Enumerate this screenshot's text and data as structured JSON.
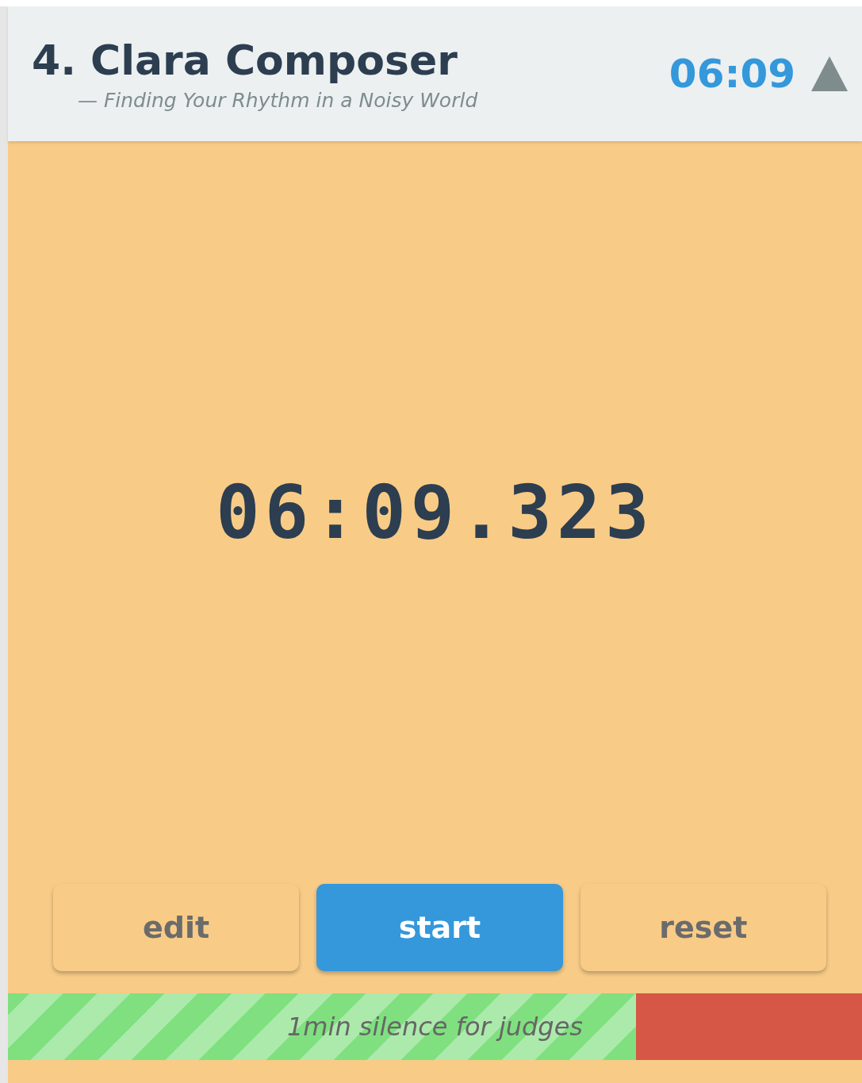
{
  "header": {
    "title": "4. Clara Composer",
    "subtitle": "— Finding Your Rhythm in a Noisy World",
    "time": "06:09"
  },
  "timer": {
    "display": "06:09.323"
  },
  "buttons": [
    {
      "label": "edit",
      "kind": "default"
    },
    {
      "label": "start",
      "kind": "primary"
    },
    {
      "label": "reset",
      "kind": "default"
    }
  ],
  "progress": {
    "label": "1min silence for judges",
    "level": 0.735
  }
}
